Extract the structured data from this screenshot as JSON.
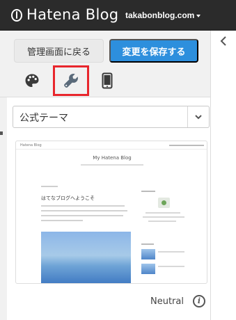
{
  "header": {
    "logo_text": "Hatena Blog",
    "blog_selector": "takabonblog.com"
  },
  "toolbar": {
    "back_label": "管理画面に戻る",
    "save_label": "変更を保存する"
  },
  "tabs": [
    {
      "name": "design",
      "icon": "palette-icon"
    },
    {
      "name": "customize",
      "icon": "wrench-icon",
      "highlighted": true
    },
    {
      "name": "smartphone",
      "icon": "smartphone-icon"
    }
  ],
  "theme_select": {
    "value": "公式テーマ"
  },
  "theme_preview": {
    "blog_title": "My Hatena Blog",
    "entry_title": "はてなブログへようこそ",
    "theme_name": "Neutral"
  },
  "colors": {
    "header_bg": "#2b2b2b",
    "save_button": "#2d8fdd",
    "highlight": "#e8262c"
  }
}
